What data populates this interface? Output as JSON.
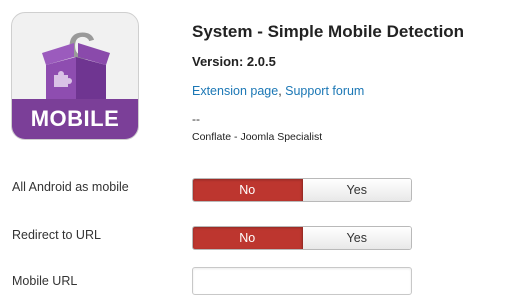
{
  "header": {
    "logo_text": "MOBILE",
    "title": "System - Simple Mobile Detection",
    "version": "Version: 2.0.5",
    "link_extension": "Extension page",
    "link_separator": ", ",
    "link_support": "Support forum",
    "dash": "--",
    "author": "Conflate - Joomla Specialist"
  },
  "fields": {
    "android": {
      "label": "All Android as mobile",
      "options": [
        "No",
        "Yes"
      ],
      "selected": "No"
    },
    "redirect": {
      "label": "Redirect to URL",
      "options": [
        "No",
        "Yes"
      ],
      "selected": "No"
    },
    "mobile_url": {
      "label": "Mobile URL",
      "value": ""
    }
  },
  "colors": {
    "accent_purple": "#7b3f98",
    "toggle_selected": "#bd362f",
    "link": "#1b77b5"
  }
}
